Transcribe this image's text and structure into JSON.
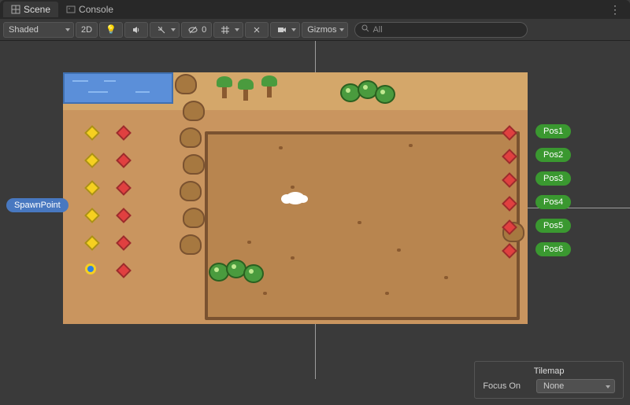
{
  "tabs": {
    "scene": "Scene",
    "console": "Console"
  },
  "toolbar": {
    "shading": "Shaded",
    "mode2d": "2D",
    "visibility": "0",
    "gizmos": "Gizmos",
    "search_placeholder": "All"
  },
  "tags": {
    "spawn": "SpawnPoint",
    "pos": [
      "Pos1",
      "Pos2",
      "Pos3",
      "Pos4",
      "Pos5",
      "Pos6"
    ]
  },
  "panel": {
    "title": "Tilemap",
    "focus_label": "Focus On",
    "focus_value": "None"
  }
}
